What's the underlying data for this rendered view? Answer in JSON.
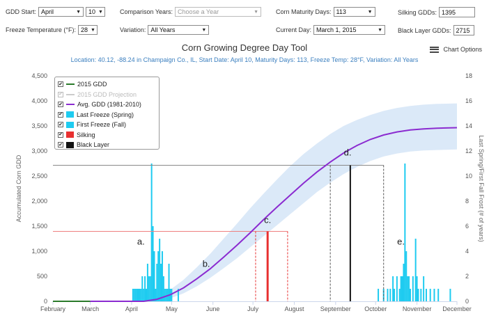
{
  "controls": {
    "gdd_start_label": "GDD Start:",
    "gdd_start_month": "April",
    "gdd_start_day": "10",
    "comparison_years_label": "Comparison Years:",
    "comparison_years_placeholder": "Choose a Year",
    "corn_maturity_label": "Corn Maturity Days:",
    "corn_maturity_value": "113",
    "silking_gdds_label": "Silking GDDs:",
    "silking_gdds_value": "1395",
    "freeze_temp_label": "Freeze Temperature (°F):",
    "freeze_temp_value": "28",
    "variation_label": "Variation:",
    "variation_value": "All Years",
    "current_day_label": "Current Day:",
    "current_day_value": "March 1, 2015",
    "black_layer_label": "Black Layer GDDs:",
    "black_layer_value": "2715"
  },
  "chart_options_label": "Chart Options",
  "chart_data": {
    "type": "line",
    "title": "Corn Growing Degree Day Tool",
    "subtitle": "Location: 40.12, -88.24 in Champaign Co., IL, Start Date: April 10, Maturity Days: 113, Freeze Temp: 28°F, Variation: All Years",
    "ylabel": "Accumulated Corn GDD",
    "y2label": "Last Spring/First Fall Frost (# of years)",
    "xlabel": "",
    "x_categories": [
      "February",
      "March",
      "April",
      "May",
      "June",
      "July",
      "August",
      "September",
      "October",
      "November",
      "December"
    ],
    "xlim_days": [
      32,
      335
    ],
    "ylim": [
      0,
      4500
    ],
    "y_ticks": [
      "0",
      "500",
      "1,000",
      "1,500",
      "2,000",
      "2,500",
      "3,000",
      "3,500",
      "4,000",
      "4,500"
    ],
    "y2lim": [
      0,
      18
    ],
    "y2_ticks": [
      "0",
      "2",
      "4",
      "6",
      "8",
      "10",
      "12",
      "14",
      "16",
      "18"
    ],
    "grid": false,
    "legend": {
      "placement": "top-left",
      "items": [
        {
          "label": "2015 GDD",
          "checked": true,
          "color": "#2a7a2a",
          "kind": "line"
        },
        {
          "label": "2015 GDD Projection",
          "checked": false,
          "color": "#cccccc",
          "kind": "dash"
        },
        {
          "label": "Avg. GDD (1981-2010)",
          "checked": true,
          "color": "#8b2bd0",
          "kind": "line"
        },
        {
          "label": "Last Freeze (Spring)",
          "checked": true,
          "color": "#1ecbf0",
          "kind": "box"
        },
        {
          "label": "First Freeze (Fall)",
          "checked": true,
          "color": "#1ecbf0",
          "kind": "box"
        },
        {
          "label": "Silking",
          "checked": true,
          "color": "#e83030",
          "kind": "box"
        },
        {
          "label": "Black Layer",
          "checked": true,
          "color": "#111111",
          "kind": "box"
        }
      ]
    },
    "series": [
      {
        "name": "2015 GDD",
        "color": "#2a7a2a",
        "x_days": [
          32,
          60
        ],
        "values": [
          0,
          0
        ]
      },
      {
        "name": "Avg. GDD (1981-2010)",
        "color": "#8b2bd0",
        "x_days": [
          60,
          100,
          110,
          120,
          130,
          140,
          150,
          160,
          170,
          180,
          190,
          200,
          210,
          220,
          230,
          240,
          250,
          260,
          270,
          280,
          290,
          300,
          310,
          320,
          335
        ],
        "values": [
          0,
          0,
          40,
          130,
          270,
          450,
          650,
          880,
          1120,
          1370,
          1630,
          1880,
          2120,
          2360,
          2580,
          2780,
          2960,
          3110,
          3230,
          3320,
          3380,
          3420,
          3440,
          3455,
          3465
        ],
        "band_upper": [
          0,
          0,
          80,
          230,
          430,
          680,
          950,
          1250,
          1550,
          1860,
          2150,
          2430,
          2700,
          2940,
          3150,
          3340,
          3500,
          3620,
          3720,
          3800,
          3860,
          3900,
          3925,
          3940,
          3950
        ],
        "band_lower": [
          0,
          0,
          10,
          60,
          160,
          300,
          470,
          660,
          860,
          1080,
          1300,
          1520,
          1740,
          1960,
          2180,
          2370,
          2540,
          2680,
          2800,
          2890,
          2950,
          2990,
          3010,
          3020,
          3030
        ]
      }
    ],
    "spring_freeze": {
      "x_days": [
        92,
        93,
        94,
        95,
        96,
        97,
        98,
        99,
        100,
        101,
        102,
        103,
        104,
        105,
        106,
        107,
        108,
        109,
        110,
        111,
        112,
        113,
        114,
        115,
        116,
        117,
        118,
        119,
        120,
        121,
        126
      ],
      "counts": [
        1,
        1,
        1,
        1,
        1,
        1,
        1,
        2,
        1,
        2,
        1,
        3,
        2,
        2,
        11,
        6,
        4,
        1,
        3,
        4,
        5,
        3,
        4,
        2,
        1,
        1,
        1,
        3,
        1,
        1,
        1
      ]
    },
    "fall_freeze": {
      "x_days": [
        276,
        280,
        283,
        285,
        287,
        288,
        290,
        292,
        293,
        294,
        295,
        296,
        297,
        298,
        299,
        300,
        302,
        304,
        305,
        306,
        308,
        310,
        312,
        315,
        318,
        321,
        330
      ],
      "counts": [
        1,
        1,
        1,
        1,
        2,
        1,
        2,
        1,
        2,
        2,
        3,
        11,
        4,
        2,
        2,
        1,
        2,
        5,
        2,
        1,
        1,
        2,
        1,
        1,
        1,
        1,
        1
      ]
    },
    "silking": {
      "day": 193,
      "gdd": 1395,
      "range_days": [
        184,
        208
      ]
    },
    "black_layer": {
      "day": 255,
      "gdd": 2715,
      "range_days": [
        240,
        280
      ]
    },
    "annotations": [
      {
        "label": "a.",
        "x_day": 98,
        "y": 1130
      },
      {
        "label": "b.",
        "x_day": 147,
        "y": 690
      },
      {
        "label": "c.",
        "x_day": 193,
        "y": 1560
      },
      {
        "label": "d.",
        "x_day": 253,
        "y": 2910
      },
      {
        "label": "e.",
        "x_day": 293,
        "y": 1130
      }
    ]
  }
}
